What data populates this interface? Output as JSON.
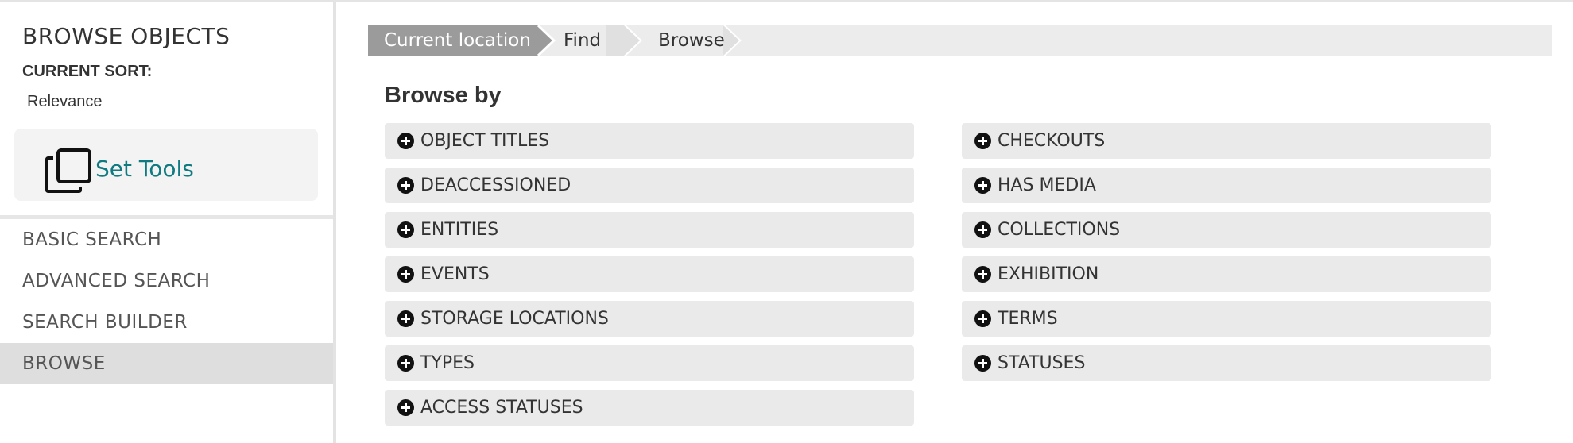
{
  "sidebar": {
    "title": "BROWSE OBJECTS",
    "current_sort_label": "CURRENT SORT:",
    "current_sort_value": "Relevance",
    "set_tools_label": "Set Tools",
    "set_tools_icon": "copy-stack-icon",
    "nav": [
      {
        "label": "BASIC SEARCH",
        "active": false
      },
      {
        "label": "ADVANCED SEARCH",
        "active": false
      },
      {
        "label": "SEARCH BUILDER",
        "active": false
      },
      {
        "label": "BROWSE",
        "active": true
      }
    ]
  },
  "breadcrumb": {
    "current": "Current location",
    "items": [
      "Find",
      "Browse"
    ]
  },
  "main": {
    "heading": "Browse by",
    "facet_icon": "plus-circle-icon",
    "facets_left": [
      "OBJECT TITLES",
      "DEACCESSIONED",
      "ENTITIES",
      "EVENTS",
      "STORAGE LOCATIONS",
      "TYPES",
      "ACCESS STATUSES"
    ],
    "facets_right": [
      "CHECKOUTS",
      "HAS MEDIA",
      "COLLECTIONS",
      "EXHIBITION",
      "TERMS",
      "STATUSES"
    ]
  },
  "colors": {
    "accent_teal": "#0f7b80",
    "crumb_current_bg": "#9b9b9b",
    "facet_bg": "#eaeaea",
    "active_nav_bg": "#dedede"
  }
}
